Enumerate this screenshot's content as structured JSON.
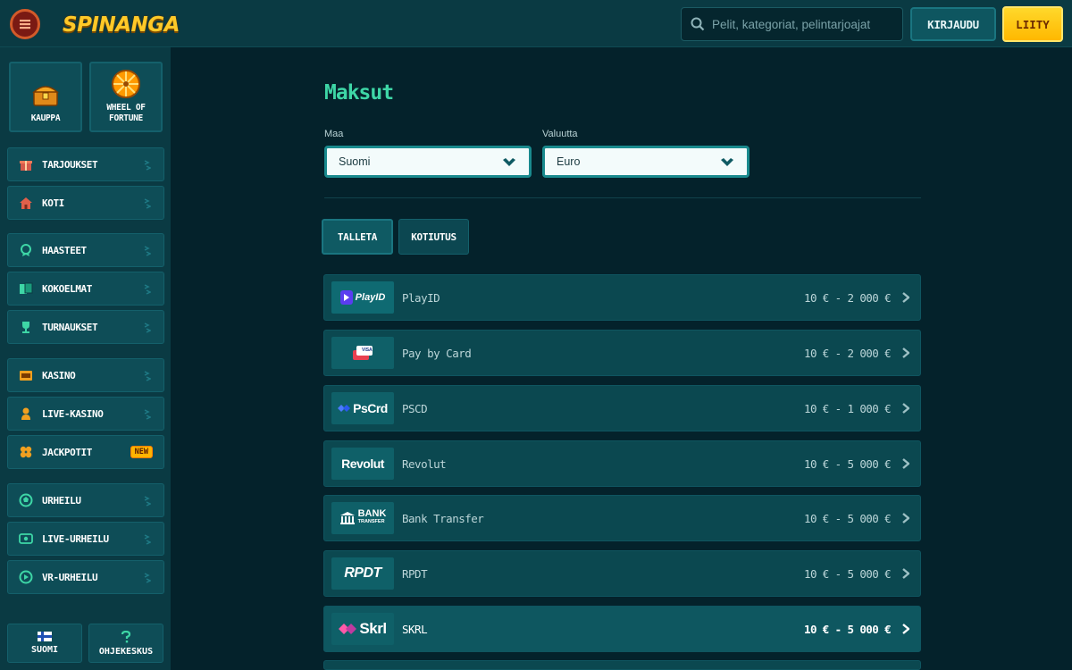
{
  "header": {
    "brand": "SPINANGA",
    "search_placeholder": "Pelit, kategoriat, pelintarjoajat",
    "login_label": "KIRJAUDU",
    "join_label": "LIITY"
  },
  "sidebar": {
    "promos": [
      {
        "label": "KAUPPA",
        "icon": "chest-icon"
      },
      {
        "label": "WHEEL OF FORTUNE",
        "icon": "wheel-icon"
      }
    ],
    "items": [
      {
        "label": "TARJOUKSET",
        "icon": "gift-icon"
      },
      {
        "label": "KOTI",
        "icon": "home-icon"
      },
      {
        "label": "HAASTEET",
        "icon": "medal-icon"
      },
      {
        "label": "KOKOELMAT",
        "icon": "cards-icon"
      },
      {
        "label": "TURNAUKSET",
        "icon": "trophy-icon"
      },
      {
        "label": "KASINO",
        "icon": "slot-icon"
      },
      {
        "label": "LIVE-KASINO",
        "icon": "dealer-icon"
      },
      {
        "label": "JACKPOTIT",
        "icon": "clover-icon",
        "badge": "NEW"
      },
      {
        "label": "URHEILU",
        "icon": "ball-icon"
      },
      {
        "label": "LIVE-URHEILU",
        "icon": "live-icon"
      },
      {
        "label": "VR-URHEILU",
        "icon": "vr-icon"
      }
    ],
    "bottom": {
      "language_label": "SUOMI",
      "help_label": "OHJEKESKUS"
    }
  },
  "main": {
    "title": "Maksut",
    "country": {
      "label": "Maa",
      "value": "Suomi"
    },
    "currency": {
      "label": "Valuutta",
      "value": "Euro"
    },
    "tabs": [
      {
        "label": "TALLETA",
        "active": true
      },
      {
        "label": "KOTIUTUS",
        "active": false
      }
    ],
    "methods": [
      {
        "logo": "PlayID",
        "name": "PlayID",
        "range": "10 € - 2 000 €"
      },
      {
        "logo": "VISA",
        "name": "Pay by Card",
        "range": "10 € - 2 000 €"
      },
      {
        "logo": "PsCrd",
        "name": "PSCD",
        "range": "10 € - 1 000 €"
      },
      {
        "logo": "Revolut",
        "name": "Revolut",
        "range": "10 € - 5 000 €"
      },
      {
        "logo": "BANK",
        "logo_sub": "TRANSFER",
        "name": "Bank Transfer",
        "range": "10 € - 5 000 €"
      },
      {
        "logo": "RPDT",
        "name": "RPDT",
        "range": "10 € - 5 000 €"
      },
      {
        "logo": "Skrl",
        "name": "SKRL",
        "range": "10 € - 5 000 €"
      }
    ]
  },
  "colors": {
    "accent_title": "#3ed6a6",
    "join_yellow": "#ffc400",
    "panel": "#0a3a43",
    "background": "#04222b"
  }
}
